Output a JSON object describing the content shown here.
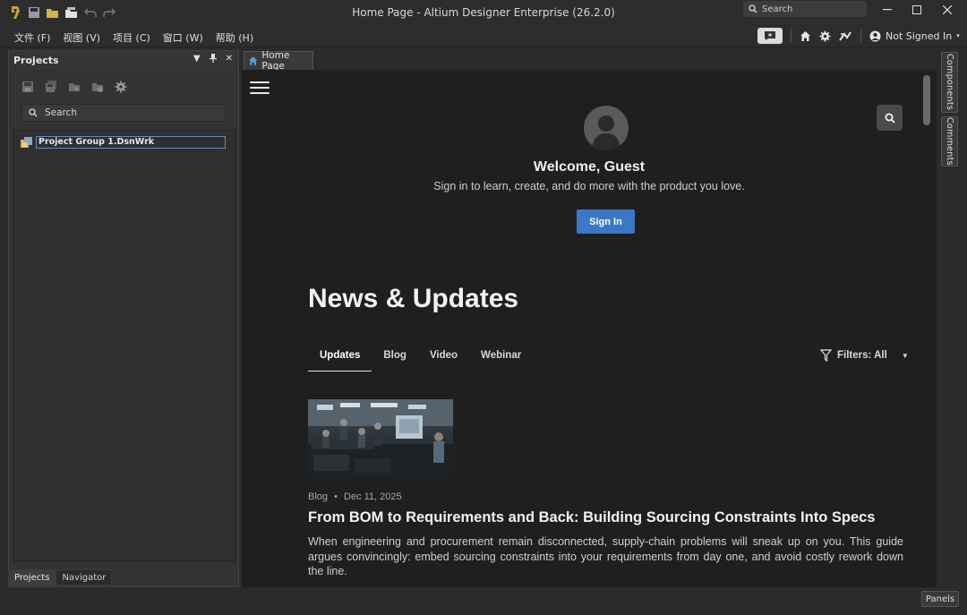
{
  "window": {
    "title": "Home Page - Altium Designer Enterprise (26.2.0)",
    "search_placeholder": "Search"
  },
  "menu": {
    "items": [
      "文件 (F)",
      "视图 (V)",
      "项目 (C)",
      "窗口 (W)",
      "帮助 (H)"
    ]
  },
  "account": {
    "status": "Not Signed In"
  },
  "projects_panel": {
    "title": "Projects",
    "search_placeholder": "Search",
    "tree": [
      {
        "label": "Project Group 1.DsnWrk"
      }
    ],
    "tabs": [
      "Projects",
      "Navigator"
    ]
  },
  "document_tab": {
    "label": "Home Page"
  },
  "home": {
    "welcome": "Welcome, Guest",
    "subtitle": "Sign in to learn, create, and do more with the product you love.",
    "sign_in": "Sign In",
    "news_title": "News & Updates",
    "tabs": [
      "Updates",
      "Blog",
      "Video",
      "Webinar"
    ],
    "active_tab": "Updates",
    "filters": "Filters: All",
    "post": {
      "category": "Blog",
      "date": "Dec 11, 2025",
      "title": "From BOM to Requirements and Back: Building Sourcing Constraints Into Specs",
      "body": "When engineering and procurement remain disconnected, supply-chain problems will sneak up on you. This guide argues convincingly: embed sourcing constraints into your requirements from day one, and avoid costly rework down the line."
    }
  },
  "side_panels": [
    "Components",
    "Comments"
  ],
  "panels_button": "Panels",
  "colors": {
    "accent": "#3b77c5",
    "background": "#1f1f1f",
    "chrome": "#2d2d2d"
  }
}
